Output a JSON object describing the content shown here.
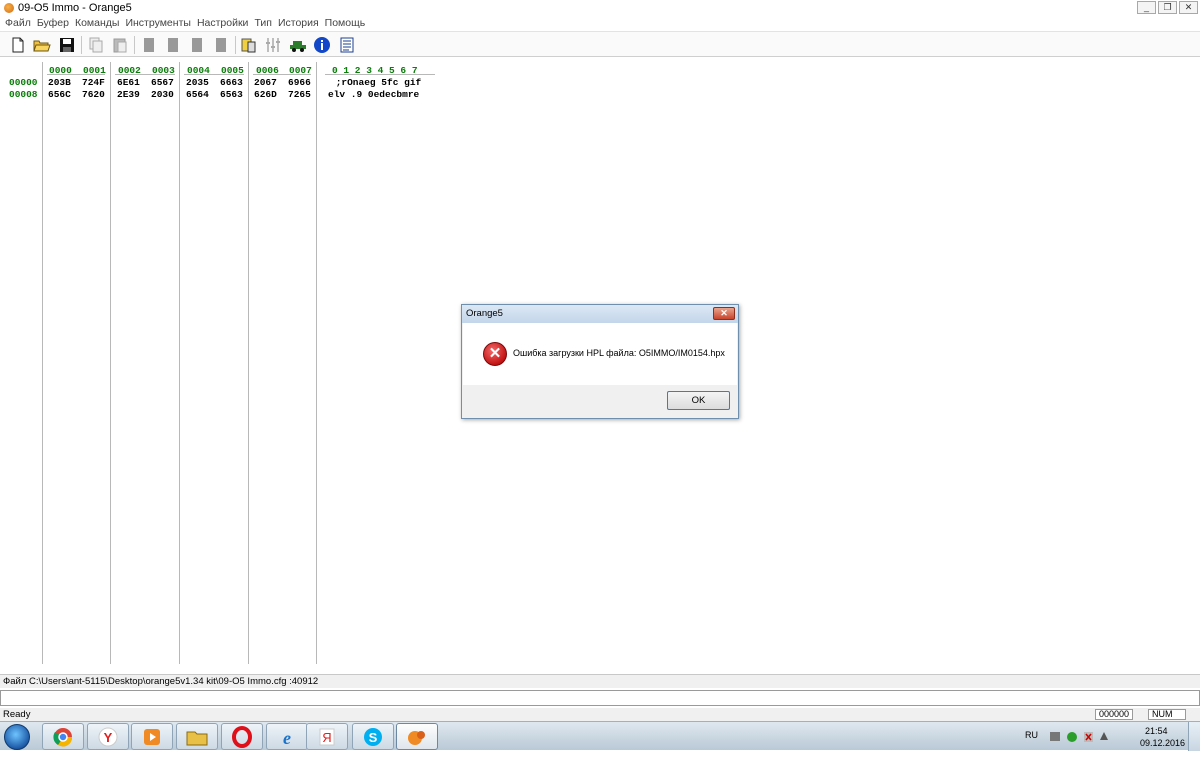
{
  "window": {
    "title": "09-O5 Immo - Orange5",
    "btn_min": "_",
    "btn_restore": "❐",
    "btn_close": "✕"
  },
  "menu": [
    "Файл",
    "Буфер",
    "Команды",
    "Инструменты",
    "Настройки",
    "Тип",
    "История",
    "Помощь"
  ],
  "hex": {
    "columns": [
      "0000",
      "0001",
      "0002",
      "0003",
      "0004",
      "0005",
      "0006",
      "0007"
    ],
    "ascii_header": "0 1 2 3 4 5 6 7",
    "rows": [
      {
        "addr": "00000",
        "words": [
          "203B",
          "724F",
          "6E61",
          "6567",
          "2035",
          "6663",
          "2067",
          "6966"
        ],
        "ascii": " ;rOnaeg 5fc gif"
      },
      {
        "addr": "00008",
        "words": [
          "656C",
          "7620",
          "2E39",
          "2030",
          "6564",
          "6563",
          "626D",
          "7265"
        ],
        "ascii": "elv .9 0edecbmre"
      }
    ]
  },
  "status_path": "Файл C:\\Users\\ant-5115\\Desktop\\orange5v1.34  kit\\09-O5 Immo.cfg :40912",
  "status": {
    "ready": "Ready",
    "counter": "000000",
    "num": "NUM"
  },
  "dialog": {
    "title": "Orange5",
    "close": "✕",
    "icon": "error-icon",
    "icon_glyph": "✕",
    "message": "Ошибка загрузки HPL файла: O5IMMO/IM0154.hpx",
    "ok": "OK"
  },
  "taskbar": {
    "apps": [
      "chrome",
      "yandex-browser",
      "media-player",
      "file-explorer",
      "opera",
      "internet-explorer",
      "yandex",
      "skype",
      "orange5"
    ],
    "lang": "RU",
    "time": "21:54",
    "date": "09.12.2016"
  }
}
